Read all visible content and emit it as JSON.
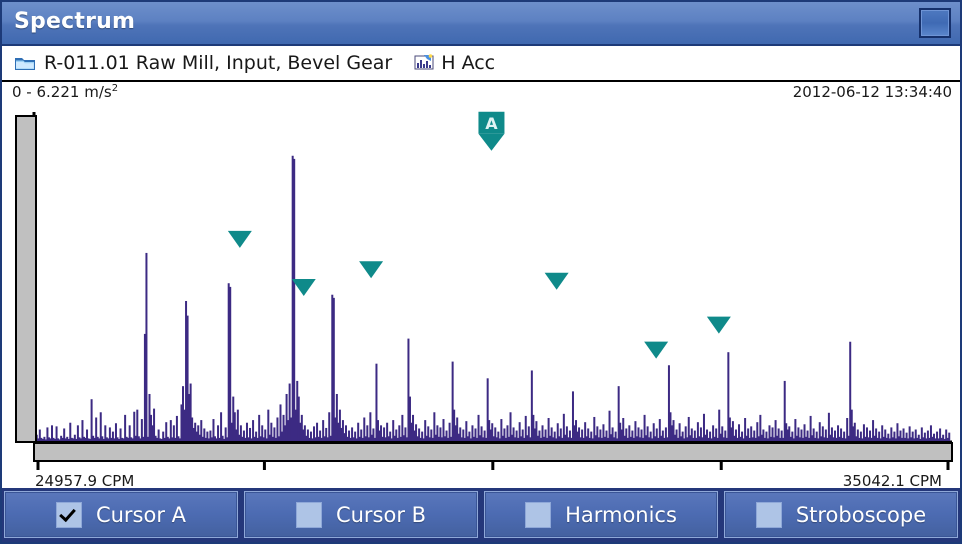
{
  "window": {
    "title": "Spectrum",
    "restore_button": "restore-button"
  },
  "breadcrumb": {
    "folder_icon": "folder-icon",
    "path": "R-011.01 Raw Mill, Input, Bevel Gear",
    "chart_icon": "measurement-icon",
    "measurement": "H Acc"
  },
  "plot_header": {
    "y_range": "0  -  6.221 m/s",
    "y_range_exponent": "2",
    "timestamp": "2012-06-12 13:34:40"
  },
  "axes": {
    "x_min_label": "24957.9 CPM",
    "x_max_label": "35042.1 CPM"
  },
  "toolbar": {
    "buttons": [
      {
        "label": "Cursor A",
        "checked": true
      },
      {
        "label": "Cursor B",
        "checked": false
      },
      {
        "label": "Harmonics",
        "checked": false
      },
      {
        "label": "Stroboscope",
        "checked": false
      }
    ]
  },
  "colors": {
    "titlebar": "#5d81c2",
    "window_border": "#1d3a78",
    "trace": "#3c2a83",
    "marker": "#0f8a8a",
    "toolbar_bg": "#24377a",
    "button_face": "#4c6bb2",
    "checkbox_face": "#aec4e6",
    "scrollbar": "#c0c0c0"
  },
  "chart_data": {
    "type": "bar",
    "title": "Spectrum",
    "xlabel": "CPM",
    "ylabel": "m/s^2",
    "xlim": [
      24957.9,
      35042.1
    ],
    "ylim": [
      0,
      6.221
    ],
    "grid": false,
    "legend": null,
    "x_ticks": [
      24957.9,
      27478.0,
      29998.0,
      32518.1,
      35042.1
    ],
    "cursor": {
      "label": "A",
      "x": 29983.0,
      "y": 5.46
    },
    "peak_markers": [
      {
        "x": 27207.0,
        "y": 3.6
      },
      {
        "x": 27912.0,
        "y": 2.68
      },
      {
        "x": 28655.0,
        "y": 3.02
      },
      {
        "x": 29983.0,
        "y": 5.46
      },
      {
        "x": 30702.0,
        "y": 2.8
      },
      {
        "x": 31800.0,
        "y": 1.48
      },
      {
        "x": 32492.0,
        "y": 1.96
      }
    ],
    "values": [
      0.12,
      0.05,
      0.22,
      0.06,
      0.04,
      0.08,
      0.03,
      0.26,
      0.07,
      0.05,
      0.3,
      0.06,
      0.04,
      0.28,
      0.05,
      0.03,
      0.1,
      0.06,
      0.24,
      0.05,
      0.08,
      0.04,
      0.35,
      0.06,
      0.05,
      0.12,
      0.04,
      0.3,
      0.07,
      0.05,
      0.4,
      0.08,
      0.06,
      0.22,
      0.05,
      0.04,
      0.8,
      0.1,
      0.06,
      0.45,
      0.08,
      0.05,
      0.55,
      0.09,
      0.04,
      0.3,
      0.07,
      0.05,
      0.26,
      0.06,
      0.18,
      0.05,
      0.34,
      0.07,
      0.04,
      0.24,
      0.06,
      0.05,
      0.5,
      0.08,
      0.06,
      0.3,
      0.07,
      0.05,
      0.56,
      0.1,
      0.6,
      0.09,
      0.05,
      0.42,
      0.08,
      2.05,
      3.6,
      0.08,
      0.9,
      0.5,
      0.3,
      0.62,
      0.1,
      0.06,
      0.22,
      0.05,
      0.04,
      0.18,
      0.06,
      0.36,
      0.08,
      0.05,
      0.4,
      0.07,
      0.3,
      0.06,
      0.48,
      0.09,
      0.05,
      0.7,
      1.05,
      0.6,
      2.68,
      2.4,
      0.9,
      1.1,
      0.45,
      0.25,
      0.35,
      0.18,
      0.3,
      0.12,
      0.4,
      0.08,
      0.24,
      0.06,
      0.18,
      0.05,
      0.2,
      0.07,
      0.42,
      0.09,
      0.05,
      0.3,
      0.06,
      0.55,
      0.1,
      0.04,
      0.26,
      0.07,
      3.02,
      2.95,
      0.35,
      0.85,
      0.55,
      0.22,
      0.6,
      0.12,
      0.3,
      0.08,
      0.2,
      0.06,
      0.35,
      0.07,
      0.25,
      0.05,
      0.4,
      0.08,
      0.18,
      0.06,
      0.5,
      0.09,
      0.3,
      0.07,
      0.22,
      0.05,
      0.6,
      0.12,
      0.35,
      0.08,
      0.26,
      0.06,
      0.45,
      0.09,
      0.7,
      0.18,
      0.5,
      0.3,
      0.9,
      0.4,
      1.1,
      0.45,
      5.46,
      5.4,
      0.6,
      1.15,
      0.85,
      0.35,
      0.5,
      0.22,
      0.3,
      0.1,
      0.22,
      0.06,
      0.18,
      0.05,
      0.28,
      0.07,
      0.35,
      0.08,
      0.2,
      0.06,
      0.4,
      0.09,
      0.25,
      0.07,
      0.55,
      0.1,
      2.8,
      2.74,
      0.45,
      0.9,
      0.35,
      0.6,
      0.25,
      0.4,
      0.15,
      0.3,
      0.08,
      0.2,
      0.06,
      0.26,
      0.07,
      0.18,
      0.05,
      0.35,
      0.08,
      0.22,
      0.06,
      0.45,
      0.09,
      0.3,
      0.07,
      0.55,
      0.12,
      0.24,
      0.06,
      1.48,
      0.4,
      0.2,
      0.3,
      0.08,
      0.26,
      0.07,
      0.35,
      0.09,
      0.18,
      0.05,
      0.4,
      0.1,
      0.22,
      0.06,
      0.3,
      0.08,
      0.5,
      0.11,
      0.26,
      0.07,
      1.96,
      0.85,
      0.35,
      0.5,
      0.2,
      0.32,
      0.09,
      0.24,
      0.06,
      0.18,
      0.05,
      0.4,
      0.1,
      0.28,
      0.07,
      0.22,
      0.06,
      0.55,
      0.12,
      0.3,
      0.08,
      0.26,
      0.07,
      0.42,
      0.09,
      0.2,
      0.06,
      0.35,
      0.08,
      1.52,
      0.6,
      0.3,
      0.45,
      0.14,
      0.26,
      0.07,
      0.22,
      0.06,
      0.38,
      0.09,
      0.18,
      0.05,
      0.3,
      0.08,
      0.24,
      0.06,
      0.5,
      0.11,
      0.28,
      0.07,
      0.2,
      0.06,
      1.2,
      0.4,
      0.22,
      0.34,
      0.09,
      0.26,
      0.07,
      0.18,
      0.05,
      0.42,
      0.1,
      0.24,
      0.06,
      0.3,
      0.08,
      0.55,
      0.12,
      0.26,
      0.07,
      0.2,
      0.06,
      0.36,
      0.09,
      0.22,
      0.06,
      0.48,
      0.11,
      0.28,
      0.07,
      1.35,
      0.5,
      0.24,
      0.38,
      0.1,
      0.2,
      0.06,
      0.3,
      0.08,
      0.22,
      0.06,
      0.44,
      0.1,
      0.26,
      0.07,
      0.18,
      0.05,
      0.34,
      0.09,
      0.24,
      0.06,
      0.52,
      0.12,
      0.28,
      0.07,
      0.2,
      0.06,
      0.95,
      0.3,
      0.4,
      0.18,
      0.26,
      0.07,
      0.22,
      0.06,
      0.36,
      0.09,
      0.24,
      0.06,
      0.18,
      0.05,
      0.46,
      0.11,
      0.28,
      0.07,
      0.22,
      0.06,
      0.32,
      0.08,
      0.2,
      0.06,
      0.58,
      0.13,
      0.26,
      0.07,
      0.18,
      0.05,
      1.05,
      0.35,
      0.22,
      0.44,
      0.1,
      0.24,
      0.06,
      0.3,
      0.08,
      0.2,
      0.06,
      0.38,
      0.09,
      0.26,
      0.07,
      0.22,
      0.06,
      0.5,
      0.11,
      0.28,
      0.07,
      0.18,
      0.05,
      0.34,
      0.09,
      0.24,
      0.06,
      0.42,
      0.1,
      0.2,
      0.06,
      0.26,
      0.07,
      1.45,
      0.55,
      0.3,
      0.4,
      0.12,
      0.22,
      0.06,
      0.34,
      0.09,
      0.18,
      0.05,
      0.28,
      0.07,
      0.46,
      0.11,
      0.24,
      0.06,
      0.2,
      0.06,
      0.36,
      0.09,
      0.26,
      0.07,
      0.52,
      0.12,
      0.22,
      0.06,
      0.18,
      0.05,
      0.3,
      0.08,
      0.24,
      0.06,
      0.6,
      0.14,
      0.28,
      0.07,
      0.2,
      0.06,
      1.7,
      0.45,
      0.26,
      0.38,
      0.1,
      0.22,
      0.06,
      0.32,
      0.08,
      0.18,
      0.05,
      0.44,
      0.1,
      0.24,
      0.06,
      0.28,
      0.07,
      0.2,
      0.06,
      0.36,
      0.09,
      0.5,
      0.12,
      0.22,
      0.06,
      0.18,
      0.05,
      0.3,
      0.08,
      0.26,
      0.07,
      0.4,
      0.1,
      0.24,
      0.06,
      0.2,
      0.06,
      1.15,
      0.34,
      0.22,
      0.28,
      0.08,
      0.18,
      0.05,
      0.42,
      0.1,
      0.26,
      0.07,
      0.22,
      0.06,
      0.32,
      0.08,
      0.2,
      0.06,
      0.48,
      0.11,
      0.24,
      0.06,
      0.18,
      0.05,
      0.36,
      0.09,
      0.28,
      0.07,
      0.22,
      0.06,
      0.54,
      0.12,
      0.26,
      0.07,
      0.2,
      0.06,
      0.3,
      0.08,
      0.24,
      0.06,
      0.18,
      0.05,
      0.44,
      0.1,
      1.9,
      0.6,
      0.28,
      0.35,
      0.09,
      0.22,
      0.06,
      0.18,
      0.05,
      0.32,
      0.08,
      0.26,
      0.07,
      0.2,
      0.06,
      0.4,
      0.1,
      0.24,
      0.06,
      0.18,
      0.05,
      0.3,
      0.08,
      0.22,
      0.06,
      0.14,
      0.05,
      0.26,
      0.07,
      0.18,
      0.05,
      0.34,
      0.09,
      0.2,
      0.06,
      0.24,
      0.06,
      0.16,
      0.05,
      0.28,
      0.07,
      0.18,
      0.05,
      0.22,
      0.06,
      0.12,
      0.04,
      0.26,
      0.07,
      0.16,
      0.05,
      0.2,
      0.06,
      0.3,
      0.08,
      0.14,
      0.05,
      0.18,
      0.05,
      0.24,
      0.06,
      0.12,
      0.04,
      0.22,
      0.06,
      0.16
    ]
  }
}
